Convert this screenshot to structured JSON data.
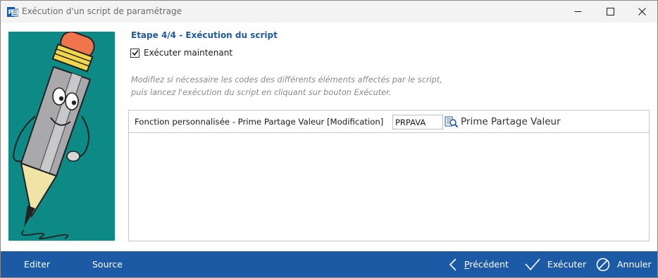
{
  "window": {
    "title": "Exécution d'un script de paramétrage"
  },
  "wizard": {
    "step_title": "Etape 4/4 - Exécution du script",
    "run_now_label": "Exécuter maintenant",
    "run_now_checked": true,
    "hint_line1": "Modifiez si nécessaire les codes des différents éléments affectés par le script,",
    "hint_line2": "puis lancez l'exécution du script en cliquant sur bouton Exécuter."
  },
  "params": {
    "row_label": "Fonction personnalisée - Prime Partage Valeur [Modification]",
    "code_value": "PRPAVA",
    "resolved_name": "Prime Partage Valeur"
  },
  "footer": {
    "editer": "Editer",
    "source": "Source",
    "prev_first": "P",
    "prev_rest": "récédent",
    "execute": "Exécuter",
    "cancel": "Annuler"
  },
  "colors": {
    "accent": "#1c5aa5",
    "step_title": "#1e5a9c",
    "mascot_bg": "#0e8a86"
  },
  "icons": [
    "app-icon",
    "minimize-icon",
    "maximize-icon",
    "close-icon",
    "pencil-mascot",
    "lookup-icon",
    "chevron-left-icon",
    "checkmark-icon",
    "cancel-circle-icon"
  ]
}
